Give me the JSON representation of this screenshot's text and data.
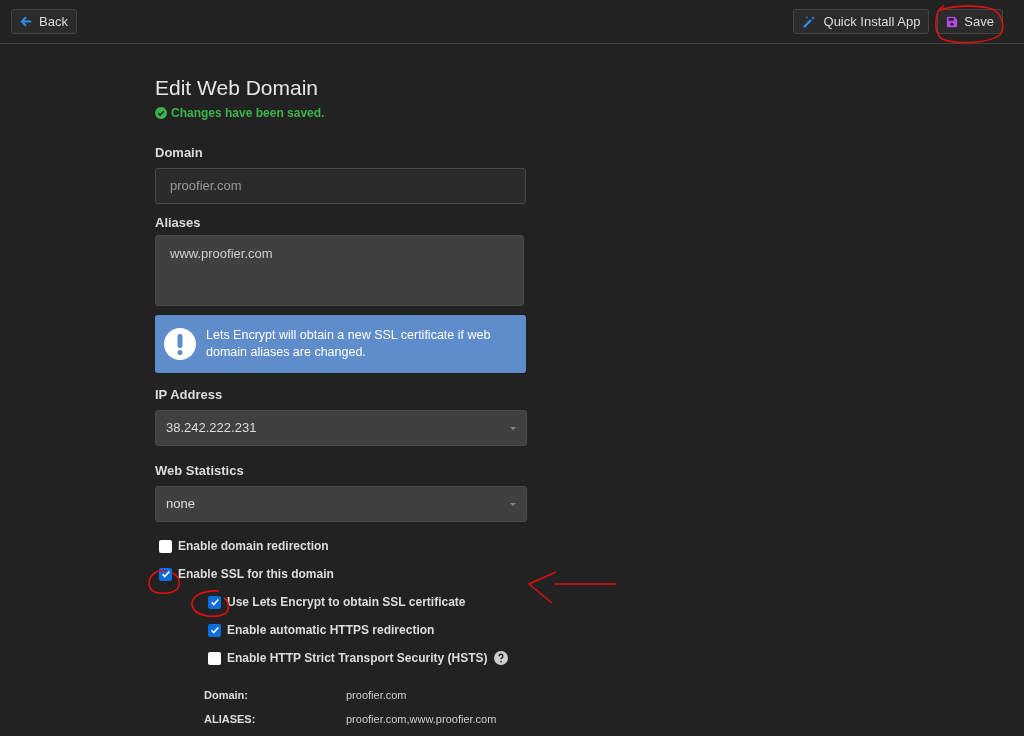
{
  "toolbar": {
    "back": {
      "label": "Back"
    },
    "quick_install": {
      "label": "Quick Install App"
    },
    "save": {
      "label": "Save"
    }
  },
  "heading": "Edit Web Domain",
  "status": "Changes have been saved.",
  "fields": [
    {
      "kind": "text",
      "label": "Domain",
      "value": "proofier.com"
    },
    {
      "kind": "textarea",
      "label": "Aliases",
      "value": "www.proofier.com"
    },
    {
      "kind": "alert",
      "text": "Lets Encrypt will obtain a new SSL certificate if web domain aliases are changed."
    },
    {
      "kind": "select",
      "label": "IP Address",
      "value": "38.242.222.231"
    },
    {
      "kind": "select",
      "label": "Web Statistics",
      "value": "none"
    }
  ],
  "options": [
    {
      "label": "Enable domain redirection",
      "checked": false,
      "has_help": false
    },
    {
      "label": "Enable SSL for this domain",
      "checked": true,
      "has_help": false,
      "children": [
        {
          "label": "Use Lets Encrypt to obtain SSL certificate",
          "checked": true,
          "has_help": false
        },
        {
          "label": "Enable automatic HTTPS redirection",
          "checked": true,
          "has_help": false
        },
        {
          "label": "Enable HTTP Strict Transport Security (HSTS)",
          "checked": false,
          "has_help": true
        }
      ]
    }
  ],
  "ssl_details": [
    {
      "label": "Domain:",
      "value": "proofier.com"
    },
    {
      "label": "ALIASES:",
      "value": "proofier.com,www.proofier.com"
    }
  ]
}
